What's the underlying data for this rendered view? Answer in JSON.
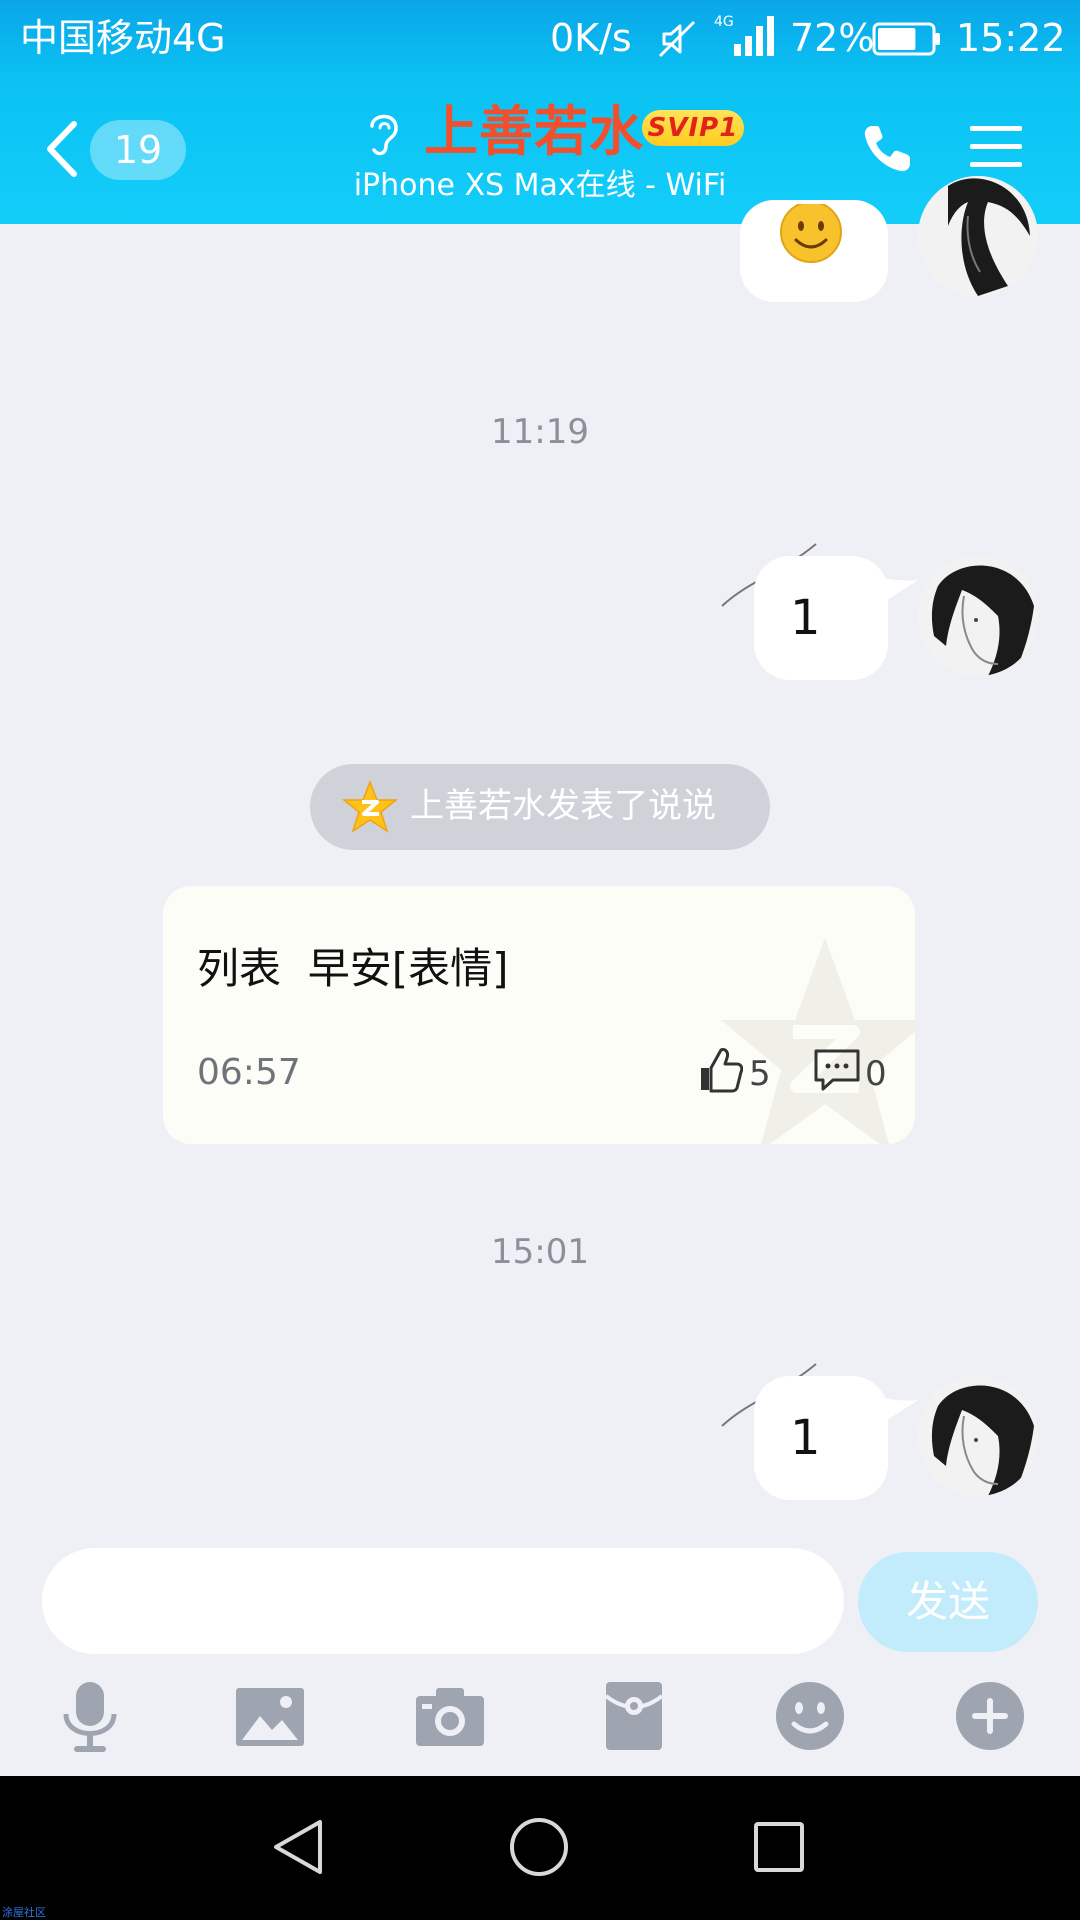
{
  "status_bar": {
    "carrier": "中国移动4G",
    "net_speed": "0K/s",
    "network_type": "4G",
    "battery_percent": "72%",
    "battery_level": 0.72,
    "time": "15:22",
    "icons": [
      "mute-icon",
      "signal-icon",
      "battery-icon"
    ]
  },
  "header": {
    "unread_count": "19",
    "contact_name": "上善若水",
    "vip_badge": "SVIP1",
    "device_status": "iPhone XS Max在线 - WiFi",
    "icons": [
      "back-icon",
      "ear-icon",
      "call-icon",
      "menu-icon"
    ]
  },
  "messages": [
    {
      "type": "sent_emoji",
      "content": "smiley-emoji"
    },
    {
      "type": "timestamp",
      "text": "11:19"
    },
    {
      "type": "sent_text",
      "text": "1"
    },
    {
      "type": "notice",
      "text": "上善若水发表了说说"
    },
    {
      "type": "post_card",
      "content": "列表  早安[表情]",
      "time": "06:57",
      "likes": "5",
      "comments": "0"
    },
    {
      "type": "timestamp",
      "text": "15:01"
    },
    {
      "type": "sent_text",
      "text": "1"
    }
  ],
  "input": {
    "value": "",
    "placeholder": "",
    "send_label": "发送"
  },
  "toolbar": [
    "mic-icon",
    "image-icon",
    "camera-icon",
    "red-packet-icon",
    "emoji-icon",
    "plus-icon"
  ],
  "navigation": [
    "back-triangle-icon",
    "home-circle-icon",
    "recents-square-icon"
  ],
  "watermark": "涂屋社区",
  "colors": {
    "header_top": "#0aa6e8",
    "header_bottom": "#13cdf9",
    "name_red": "#f0502e",
    "chat_bg": "#eef0f6",
    "send_button": "#c2ecfb"
  }
}
